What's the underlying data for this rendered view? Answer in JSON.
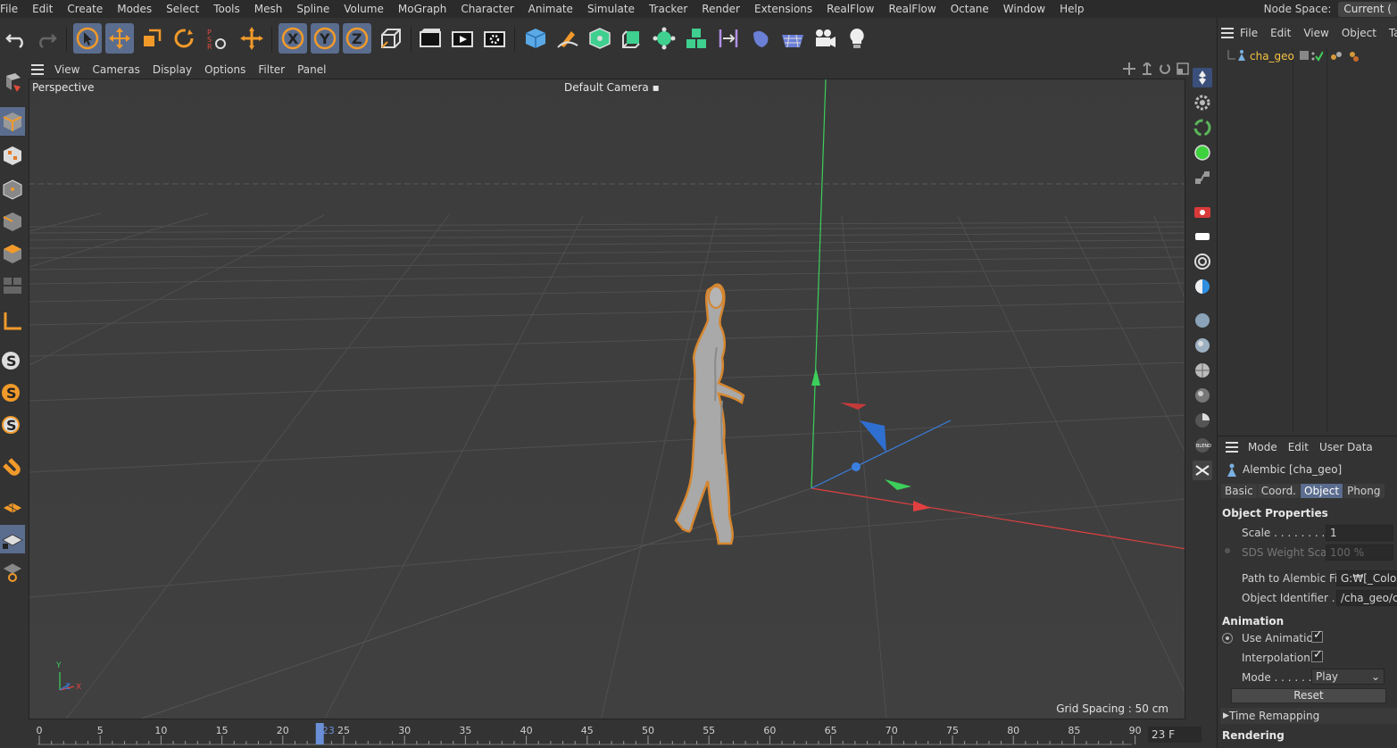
{
  "menubar": {
    "items": [
      "File",
      "Edit",
      "Create",
      "Modes",
      "Select",
      "Tools",
      "Mesh",
      "Spline",
      "Volume",
      "MoGraph",
      "Character",
      "Animate",
      "Simulate",
      "Tracker",
      "Render",
      "Extensions",
      "RealFlow",
      "RealFlow",
      "Octane",
      "Window",
      "Help"
    ],
    "node_space_label": "Node Space:",
    "node_space_value": "Current ("
  },
  "toolbar": {
    "icons": [
      "undo-icon",
      "redo-icon",
      "select-icon",
      "move-icon",
      "scale-icon",
      "rotate-icon",
      "psr-icon",
      "transform-icon",
      "x-axis-icon",
      "y-axis-icon",
      "z-axis-icon",
      "coordinate-system-icon",
      "render-region-icon",
      "render-view-icon",
      "render-settings-icon",
      "cube-icon",
      "pen-icon",
      "subdivision-icon",
      "extrude-icon",
      "mograph-icon",
      "cloner-icon",
      "deformer-icon",
      "environment-icon",
      "floor-icon",
      "camera-icon",
      "light-icon"
    ]
  },
  "viewport_menu": {
    "items": [
      "View",
      "Cameras",
      "Display",
      "Options",
      "Filter",
      "Panel"
    ]
  },
  "viewport": {
    "label": "Perspective",
    "camera": "Default Camera",
    "grid_spacing": "Grid Spacing : 50 cm",
    "axis_x": "X",
    "axis_y": "Y",
    "axis_z": "Z"
  },
  "object_manager": {
    "menu": [
      "File",
      "Edit",
      "View",
      "Object",
      "Tags"
    ],
    "object_name": "cha_geo"
  },
  "attributes": {
    "menu": [
      "Mode",
      "Edit",
      "User Data"
    ],
    "title": "Alembic [cha_geo]",
    "tabs": [
      "Basic",
      "Coord.",
      "Object",
      "Phong"
    ],
    "active_tab": "Object",
    "object_properties": "Object Properties",
    "scale_label": "Scale . . . . . . . . .",
    "scale_value": "1",
    "sds_label": "SDS Weight Scale",
    "sds_value": "100 %",
    "path_label": "Path to Alembic File",
    "path_value": "G:₩[_Coloso",
    "identifier_label": "Object Identifier . .",
    "identifier_value": "/cha_geo/cha",
    "animation_section": "Animation",
    "use_animation": "Use Animation",
    "interpolation": "Interpolation",
    "mode_label": "Mode . . . . . .",
    "mode_value": "Play",
    "reset": "Reset",
    "time_remapping": "Time Remapping",
    "rendering_section": "Rendering"
  },
  "timeline": {
    "ticks": [
      "0",
      "5",
      "10",
      "15",
      "20",
      "25",
      "30",
      "35",
      "40",
      "45",
      "50",
      "55",
      "60",
      "65",
      "70",
      "75",
      "80",
      "85",
      "90"
    ],
    "current_frame": "23",
    "frame_field": "23 F"
  }
}
